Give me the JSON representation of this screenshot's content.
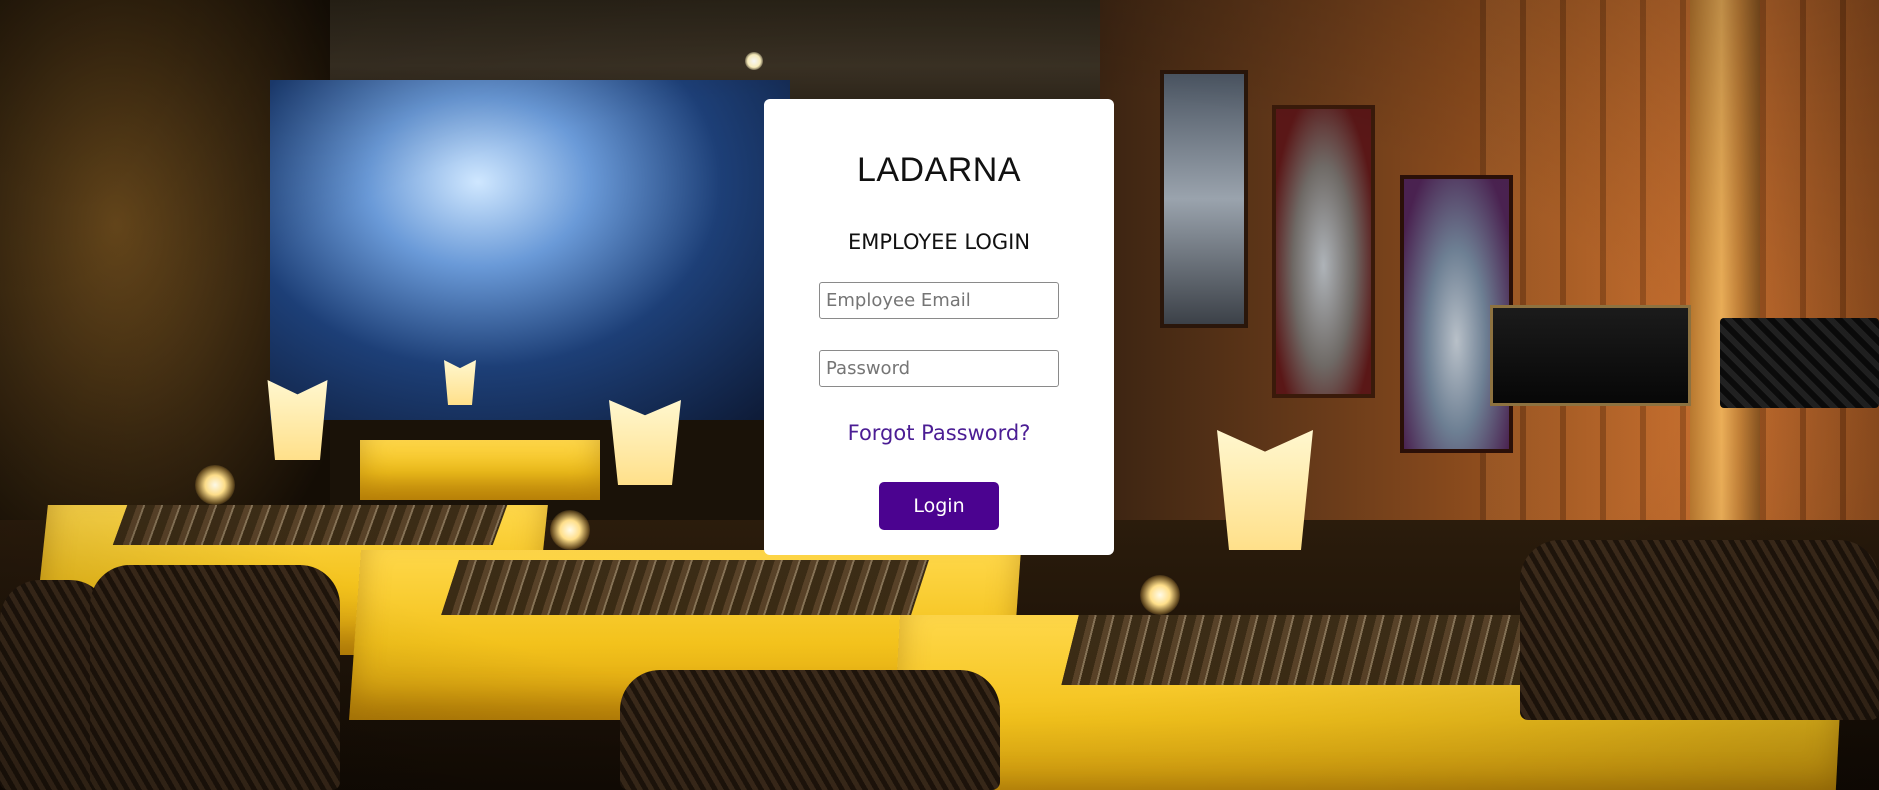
{
  "login": {
    "brand": "LADARNA",
    "subtitle": "EMPLOYEE LOGIN",
    "email_placeholder": "Employee Email",
    "email_value": "",
    "password_placeholder": "Password",
    "password_value": "",
    "forgot_link": "Forgot Password?",
    "login_button": "Login"
  },
  "colors": {
    "card_background": "#ffffff",
    "link_color": "#4b1d94",
    "button_background": "#4b0390",
    "button_text": "#ffffff"
  }
}
